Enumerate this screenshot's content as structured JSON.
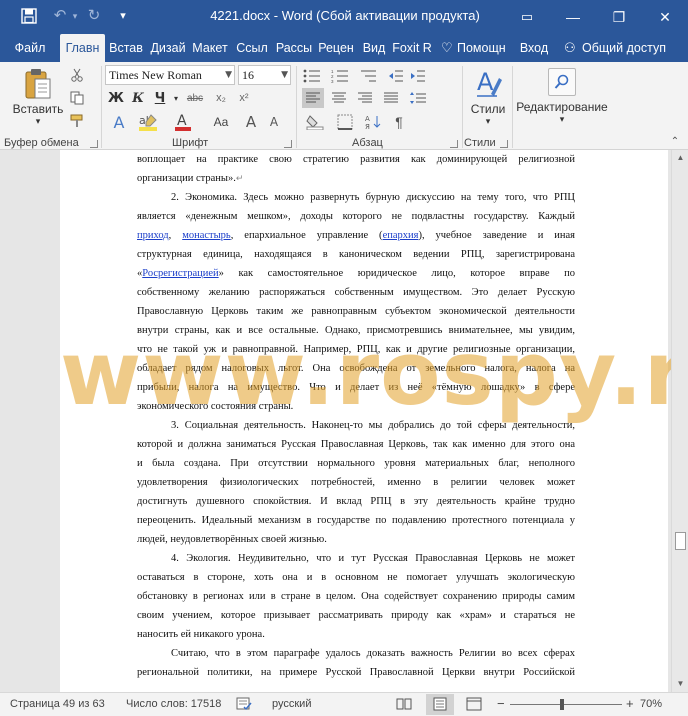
{
  "window": {
    "title": "4221.docx - Word (Сбой активации продукта)",
    "controls": {
      "minimize": "—",
      "restore": "❐",
      "close": "✕",
      "ribbon_options": "▭"
    }
  },
  "quick_access": {
    "save": "save-icon",
    "undo": "↶",
    "redo": "↻",
    "customize": "▾"
  },
  "tabs": [
    {
      "label": "Файл"
    },
    {
      "label": "Главн"
    },
    {
      "label": "Встав"
    },
    {
      "label": "Дизай"
    },
    {
      "label": "Макет"
    },
    {
      "label": "Ссыл"
    },
    {
      "label": "Рассы"
    },
    {
      "label": "Рецен"
    },
    {
      "label": "Вид"
    },
    {
      "label": "Foxit R"
    },
    {
      "label": "Помощн"
    },
    {
      "label": "Вход"
    },
    {
      "label": "Общий доступ"
    }
  ],
  "ribbon": {
    "clipboard": {
      "paste_label": "Вставить",
      "group_label": "Буфер обмена"
    },
    "font": {
      "name": "Times New Roman",
      "size": "16",
      "group_label": "Шрифт",
      "bold": "Ж",
      "italic": "К",
      "underline": "Ч",
      "strike": "abc",
      "subscript": "x₂",
      "superscript": "x²",
      "grow": "A",
      "shrink": "A",
      "case": "Aa",
      "text_effects": "A",
      "font_color": "A",
      "font_color_value": "#d32f2f",
      "highlight_color_value": "#f5e04a"
    },
    "paragraph": {
      "group_label": "Абзац"
    },
    "styles": {
      "label": "Стили",
      "group_label": "Стили"
    },
    "editing": {
      "label": "Редактирование"
    }
  },
  "accent_color": "#2b579a",
  "document": {
    "watermark": "www.rospy.ru",
    "lines": {
      "l01": "воплощает на практике свою стратегию развития как доминирующей религиозной",
      "l02": "организации страны».",
      "l03": "2. Экономика. Здесь можно развернуть бурную дискуссию на тему того, что РПЦ",
      "l04": "является «денежным мешком», доходы которого не подвластны государству. Каждый",
      "l05_link1": "приход",
      "l05_link2": "монастырь",
      "l05_mid": ", епархиальное управление (",
      "l05_link3": "епархия",
      "l05_end": "), учебное заведение и иная",
      "l06": "структурная единица, находящаяся в каноническом ведении РПЦ, зарегистрирована",
      "l07_open": "«",
      "l07_link": "Росрегистрацией",
      "l07_rest": "» как самостоятельное юридическое лицо, которое вправе по",
      "l08": "собственному желанию распоряжаться собственным имуществом. Это делает Русскую",
      "l09": "Православную Церковь таким же равноправным субъектом экономической деятельности",
      "l10": "внутри страны, как и все остальные. Однако, присмотревшись внимательнее, мы увидим,",
      "l11": "что не такой уж и равноправной. Например, РПЦ, как и другие религиозные организации,",
      "l12": "обладает рядом налоговых льгот. Она освобождена от земельного налога, налога на",
      "l13": "прибыли, налога на имущество. Что и делает из неё «тёмную лошадку» в сфере",
      "l14": "экономического состояния страны.",
      "l15": "3. Социальная деятельность. Наконец-то мы добрались до той сферы деятельности,",
      "l16": "которой и должна заниматься Русская Православная Церковь, так как именно для этого она",
      "l17": "и была создана. При отсутствии нормального уровня материальных благ, неполного",
      "l18": "удовлетворения физиологических потребностей, именно в религии человек может",
      "l19": "достигнуть душевного спокойствия. И вклад РПЦ в эту деятельность крайне трудно",
      "l20": "переоценить. Идеальный механизм в государстве по подавлению протестного потенциала у",
      "l21": "людей, неудовлетворённых своей жизнью.",
      "l22": "4. Экология. Неудивительно, что и тут Русская Православная Церковь не может",
      "l23": "оставаться в стороне, хоть она и в основном не помогает улучшать экологическую",
      "l24": "обстановку в регионах или в стране в целом. Она содействует сохранению природы самим",
      "l25": "своим учением, которое призывает рассматривать природу как «храм» и стараться не",
      "l26": "наносить ей никакого урона.",
      "l27": "Считаю, что в этом параграфе удалось доказать важность Религии во всех сферах",
      "l28": "региональной политики, на примере Русской Православной Церкви внутри Российской"
    }
  },
  "status": {
    "page": "Страница 49 из 63",
    "words": "Число слов: 17518",
    "language": "русский",
    "zoom": "70%",
    "zoom_minus": "−",
    "zoom_plus": "+"
  }
}
